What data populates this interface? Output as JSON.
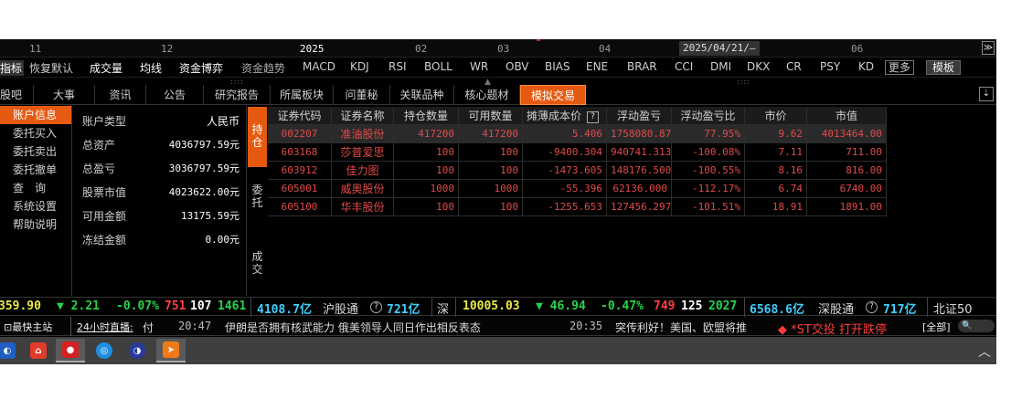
{
  "timeaxis": {
    "ticks": [
      "11",
      "12",
      "2025",
      "02",
      "03",
      "04",
      "06"
    ],
    "date_box": "2025/04/21/—",
    "expand": "≫"
  },
  "indicators": {
    "items": [
      "指标",
      "恢复默认",
      "成交量",
      "均线",
      "资金博弈",
      "资金趋势",
      "MACD",
      "KDJ",
      "RSI",
      "BOLL",
      "WR",
      "OBV",
      "BIAS",
      "ENE",
      "BRAR",
      "CCI",
      "DMI",
      "DKX",
      "CR",
      "PSY",
      "KD"
    ],
    "more": "更多",
    "template": "模板"
  },
  "tabs": [
    "股吧",
    "大事",
    "资讯",
    "公告",
    "研究报告",
    "所属板块",
    "问董秘",
    "关联品种",
    "核心题材",
    "模拟交易"
  ],
  "tab_corner": "⇣",
  "leftnav": [
    "账户信息",
    "委托买入",
    "委托卖出",
    "委托撤单",
    "查　询",
    "系统设置",
    "帮助说明"
  ],
  "account": {
    "rows": [
      {
        "label": "账户类型",
        "value": "人民币"
      },
      {
        "label": "总资产",
        "value": "4036797.59元"
      },
      {
        "label": "总盈亏",
        "value": "3036797.59元"
      },
      {
        "label": "股票市值",
        "value": "4023622.00元"
      },
      {
        "label": "可用金额",
        "value": "13175.59元"
      },
      {
        "label": "冻结金额",
        "value": "0.00元"
      }
    ]
  },
  "vtabs": [
    "持仓",
    "委托",
    "成交"
  ],
  "holdings": {
    "headers": [
      "证券代码",
      "证券名称",
      "持仓数量",
      "可用数量",
      "摊薄成本价",
      "浮动盈亏",
      "浮动盈亏比",
      "市价",
      "市值"
    ],
    "help": "?",
    "rows": [
      [
        "002207",
        "准油股份",
        "417200",
        "417200",
        "5.406",
        "1758080.875",
        "77.95%",
        "9.62",
        "4013464.00"
      ],
      [
        "603168",
        "莎普爱思",
        "100",
        "100",
        "-9400.304",
        "940741.313",
        "-100.08%",
        "7.11",
        "711.00"
      ],
      [
        "603912",
        "佳力图",
        "100",
        "100",
        "-1473.605",
        "148176.500",
        "-100.55%",
        "8.16",
        "816.00"
      ],
      [
        "605001",
        "威奥股份",
        "1000",
        "1000",
        "-55.396",
        "62136.000",
        "-112.17%",
        "6.74",
        "6740.00"
      ],
      [
        "605100",
        "华丰股份",
        "100",
        "100",
        "-1255.653",
        "127456.297",
        "-101.51%",
        "18.91",
        "1891.00"
      ]
    ]
  },
  "market": {
    "sh_index": "359.90",
    "sh_chg": "▼ 2.21",
    "sh_pct": "-0.07%",
    "sh_up": "751",
    "sh_flat": "107",
    "sh_down": "1461",
    "sh_amt": "4108.7亿",
    "hgt_label": "沪股通",
    "hgt_q": "?",
    "hgt_val": "721亿",
    "sz_label": "深",
    "sz_index": "10005.03",
    "sz_chg": "▼ 46.94",
    "sz_pct": "-0.47%",
    "sz_up": "749",
    "sz_flat": "125",
    "sz_down": "2027",
    "sz_amt": "6568.6亿",
    "sgt_label": "深股通",
    "sgt_q": "?",
    "sgt_val": "717亿",
    "bz_label": "北证50"
  },
  "news": {
    "home": "最快主站",
    "live": "24小时直播:",
    "live_suffix": "付",
    "t1": "20:47",
    "h1": "伊朗是否拥有核武能力 俄美领导人同日作出相反表态",
    "t2": "20:35",
    "h2": "突传利好！美国、欧盟将推",
    "alert": "◆ *ST交投 打开跌停",
    "all": "[全部]",
    "search": "🔍"
  },
  "colors": {
    "accent": "#e55a10",
    "loss_red": "#e34a4a",
    "up_green": "#28d34a",
    "index_yellow": "#e8e84a",
    "amount_cyan": "#3fd0ff"
  }
}
